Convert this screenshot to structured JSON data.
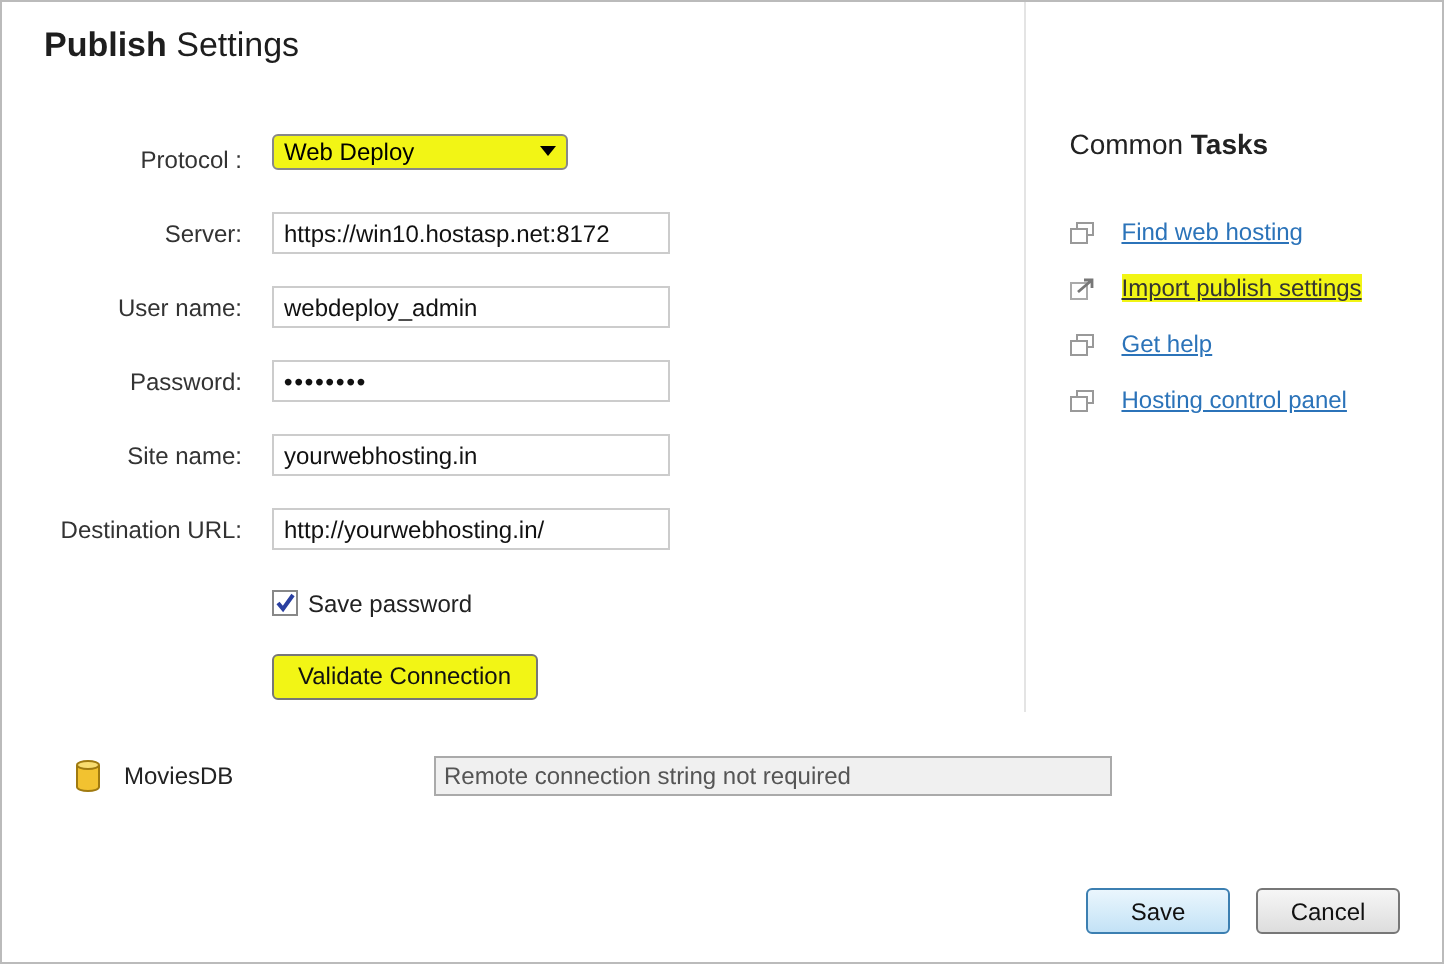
{
  "title": "**Publish** Settings",
  "fields": [
    {
      "kind": "select",
      "label": "Protocol :",
      "value": "Web Deploy",
      "highlighted": true
    },
    {
      "kind": "text",
      "label": "Server:",
      "value": "https://win10.hostasp.net:8172"
    },
    {
      "kind": "text",
      "label": "User name:",
      "value": "webdeploy_admin"
    },
    {
      "kind": "password",
      "label": "Password:",
      "value": "••••••••"
    },
    {
      "kind": "text",
      "label": "Site name:",
      "value": "yourwebhosting.in"
    },
    {
      "kind": "text",
      "label": "Destination URL:",
      "value": "http://yourwebhosting.in/"
    }
  ],
  "save_password": {
    "label": "Save password",
    "checked": true
  },
  "validate_button": {
    "label": "Validate Connection",
    "highlighted": true
  },
  "database": {
    "name": "MoviesDB",
    "connection": "Remote connection string not required"
  },
  "common_tasks": {
    "title": "Common **Tasks**",
    "links": [
      {
        "kind": "window",
        "label": "Find web hosting",
        "highlighted": false
      },
      {
        "kind": "import",
        "label": "Import publish settings",
        "highlighted": true
      },
      {
        "kind": "window",
        "label": "Get help",
        "highlighted": false
      },
      {
        "kind": "window",
        "label": "Hosting control panel",
        "highlighted": false
      }
    ]
  },
  "buttons": [
    {
      "label": "Save",
      "default": true
    },
    {
      "label": "Cancel",
      "default": false
    }
  ]
}
